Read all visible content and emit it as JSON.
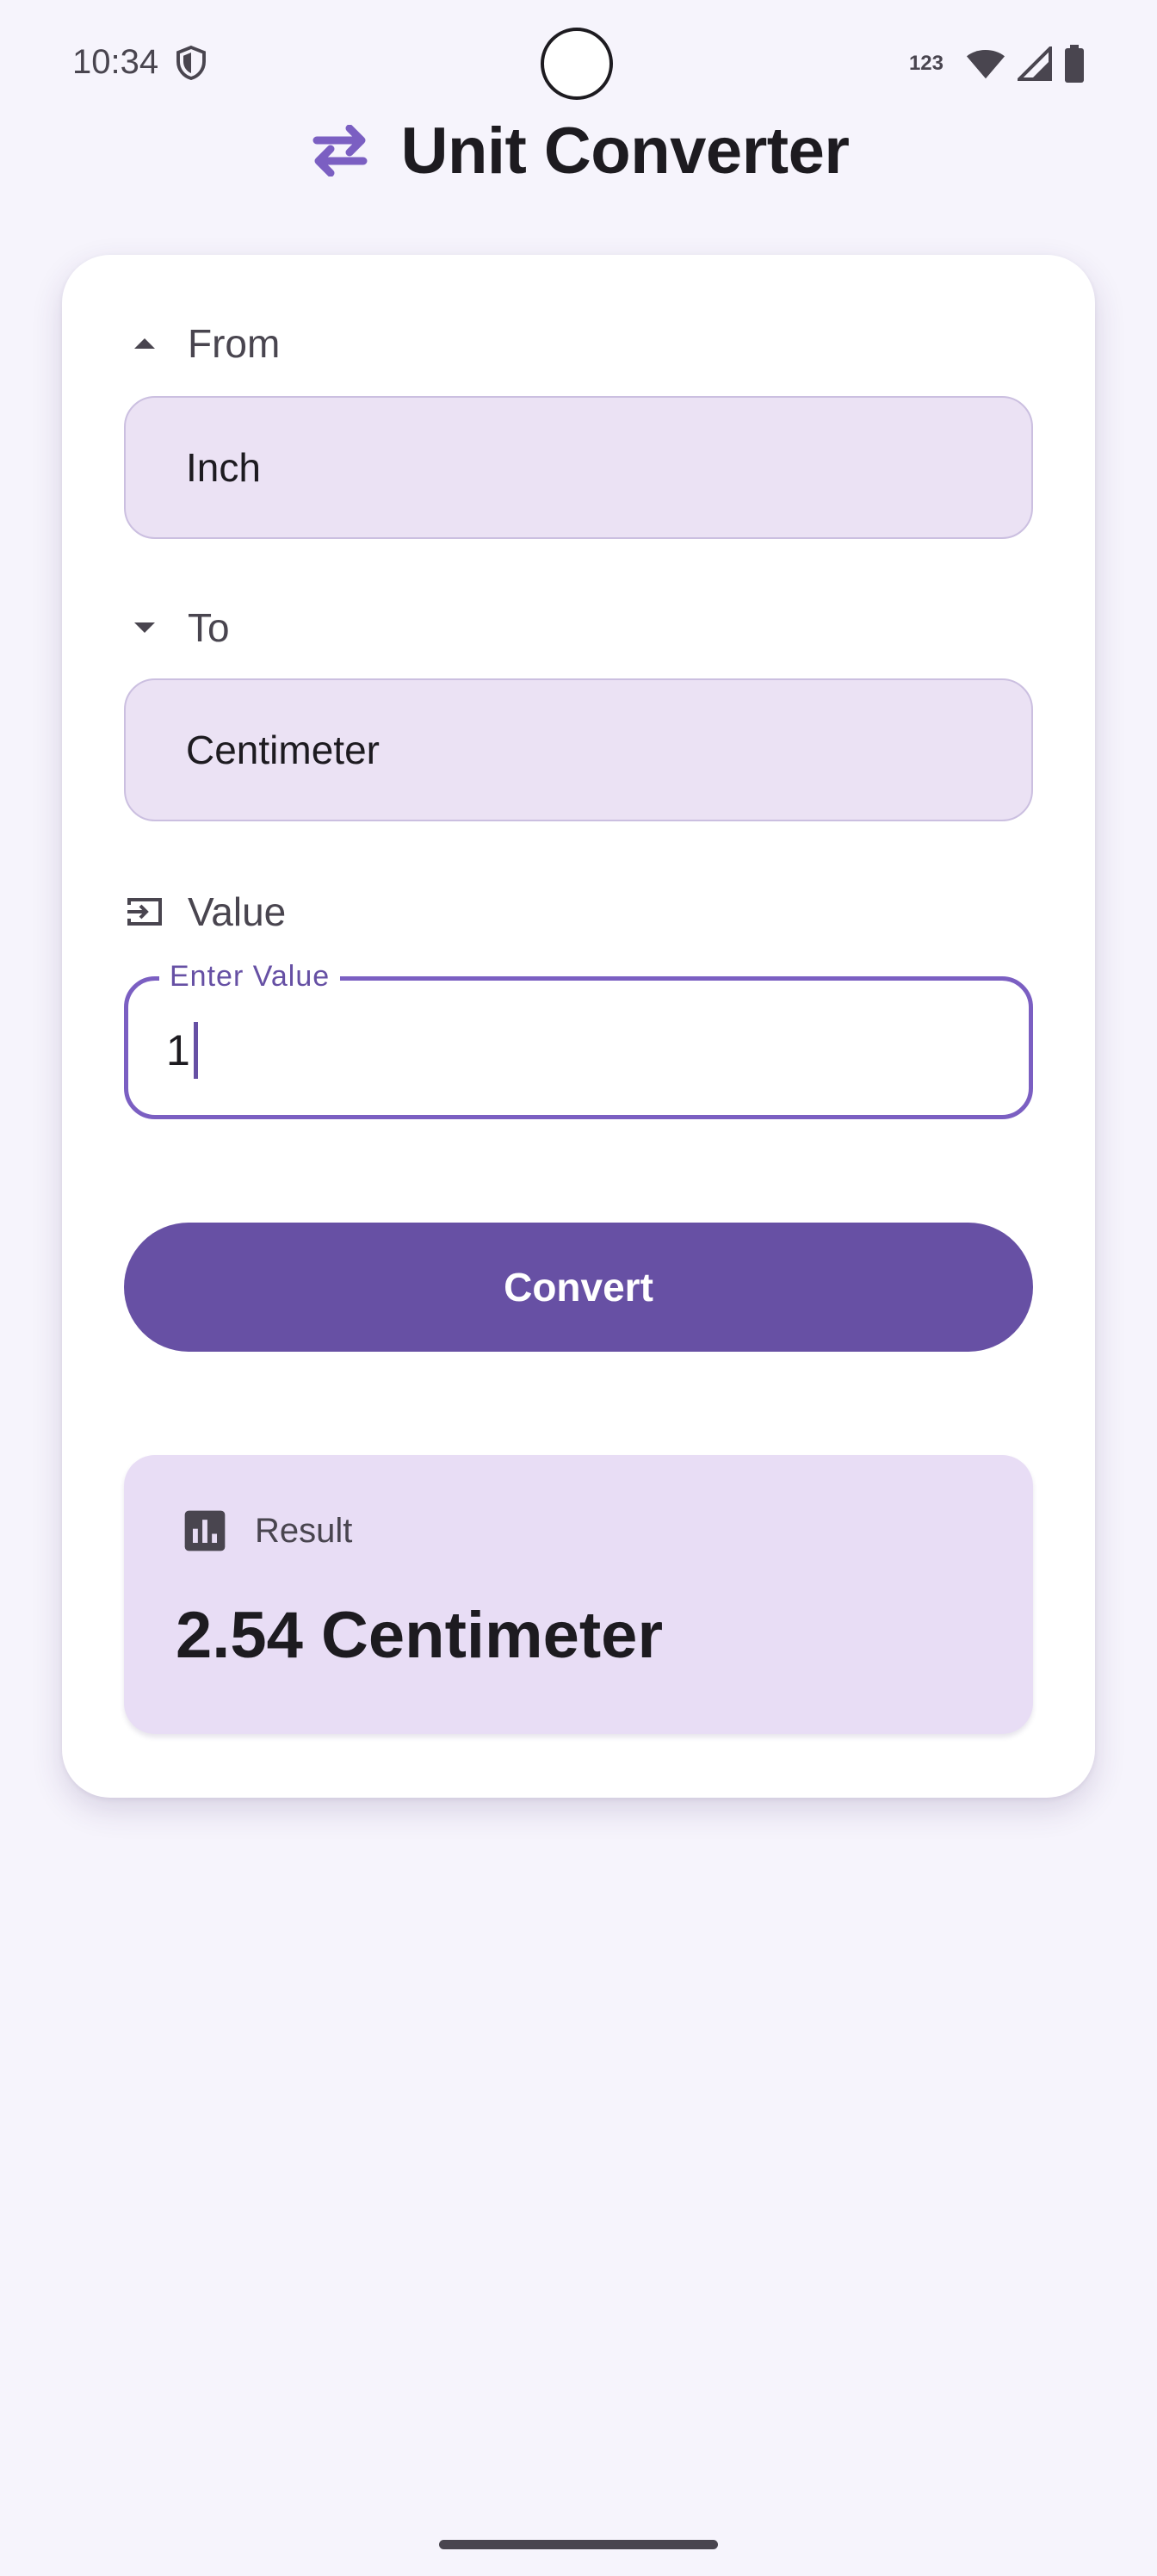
{
  "status_bar": {
    "time": "10:34",
    "keyboard_indicator": "123",
    "icons": [
      "shield-icon",
      "wifi-icon",
      "cell-signal-icon",
      "battery-icon"
    ]
  },
  "header": {
    "title": "Unit Converter",
    "icon": "swap-arrows-icon"
  },
  "form": {
    "from": {
      "label": "From",
      "icon": "arrow-drop-up-icon",
      "selected": "Inch"
    },
    "to": {
      "label": "To",
      "icon": "arrow-drop-down-icon",
      "selected": "Centimeter"
    },
    "value": {
      "label": "Value",
      "icon": "input-icon",
      "field_label": "Enter Value",
      "input": "1"
    },
    "convert_label": "Convert"
  },
  "result": {
    "label": "Result",
    "icon": "bar-chart-icon",
    "value": "2.54 Centimeter"
  },
  "colors": {
    "primary": "#6750a4",
    "background": "#f6f4fc",
    "field_fill": "#ebe2f4",
    "result_fill": "#e8ddf5"
  }
}
